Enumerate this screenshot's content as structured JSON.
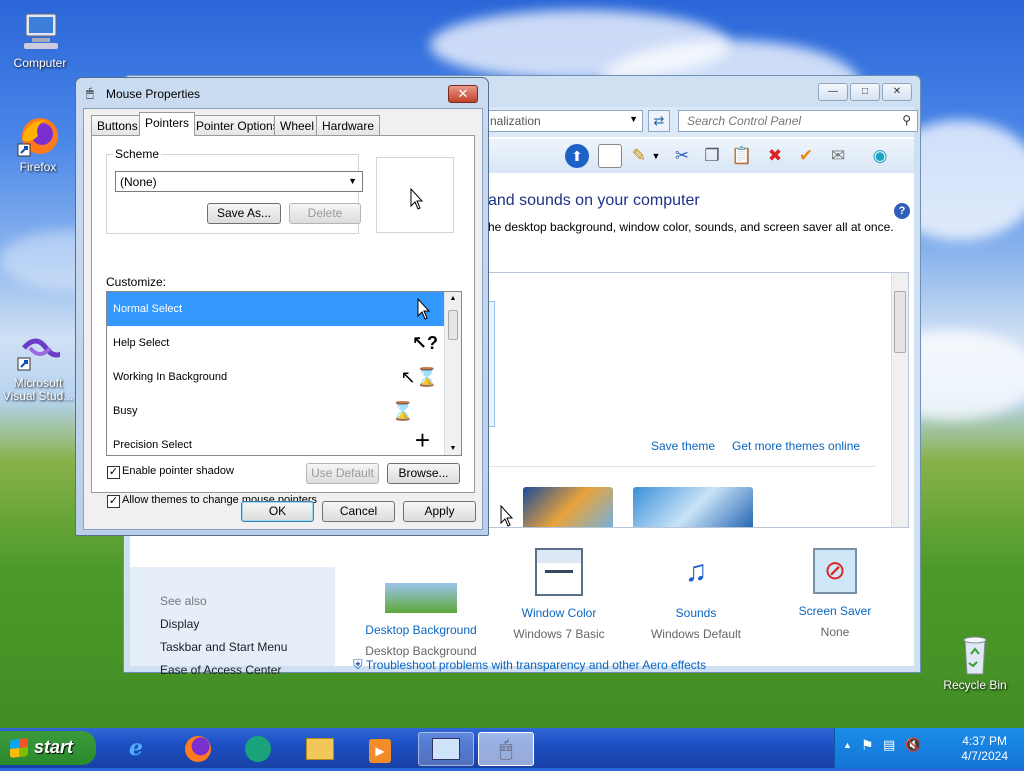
{
  "desktop": {
    "icons": [
      {
        "name": "computer",
        "label": "Computer"
      },
      {
        "name": "firefox",
        "label": "Firefox"
      },
      {
        "name": "visual-studio",
        "label": "Microsoft Visual Stud..."
      },
      {
        "name": "recycle-bin",
        "label": "Recycle Bin"
      }
    ]
  },
  "control_panel": {
    "address": "nalization",
    "search_placeholder": "Search Control Panel",
    "heading": "and sounds on your computer",
    "subheading": "he desktop background, window color, sounds, and screen saver all at once.",
    "save_theme": "Save theme",
    "get_more": "Get more themes online",
    "items": [
      {
        "label": "Desktop Background",
        "value": "Desktop Background"
      },
      {
        "label": "Window Color",
        "value": "Windows 7 Basic"
      },
      {
        "label": "Sounds",
        "value": "Windows Default"
      },
      {
        "label": "Screen Saver",
        "value": "None"
      }
    ],
    "troubleshoot": "Troubleshoot problems with transparency and other Aero effects",
    "see_also": {
      "title": "See also",
      "links": [
        "Display",
        "Taskbar and Start Menu",
        "Ease of Access Center"
      ]
    }
  },
  "mouse_dialog": {
    "title": "Mouse Properties",
    "tabs": [
      "Buttons",
      "Pointers",
      "Pointer Options",
      "Wheel",
      "Hardware"
    ],
    "active_tab": "Pointers",
    "scheme_label": "Scheme",
    "scheme_value": "(None)",
    "save_as": "Save As...",
    "delete": "Delete",
    "customize_label": "Customize:",
    "pointers": [
      {
        "name": "Normal Select",
        "icon": "arrow-cursor"
      },
      {
        "name": "Help Select",
        "icon": "help-cursor"
      },
      {
        "name": "Working In Background",
        "icon": "working-cursor"
      },
      {
        "name": "Busy",
        "icon": "hourglass-cursor"
      },
      {
        "name": "Precision Select",
        "icon": "crosshair-cursor"
      }
    ],
    "selected_pointer": "Normal Select",
    "shadow_label": "Enable pointer shadow",
    "shadow_checked": true,
    "themes_label": "Allow themes to change mouse pointers",
    "themes_checked": true,
    "use_default": "Use Default",
    "browse": "Browse...",
    "ok": "OK",
    "cancel": "Cancel",
    "apply": "Apply"
  },
  "taskbar": {
    "start": "start",
    "time": "4:37 PM",
    "date": "4/7/2024"
  }
}
